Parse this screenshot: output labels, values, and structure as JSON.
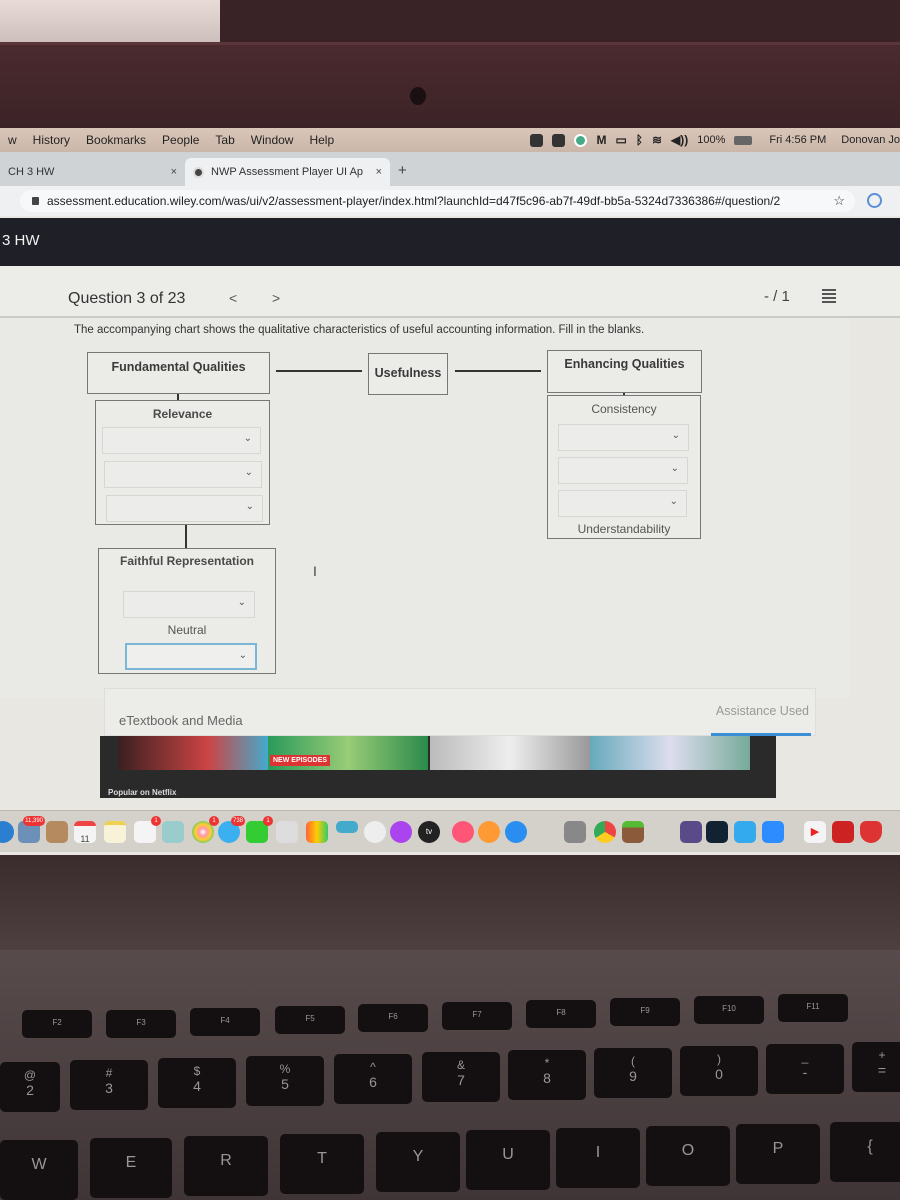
{
  "menubar": {
    "items": [
      "w",
      "History",
      "Bookmarks",
      "People",
      "Tab",
      "Window",
      "Help"
    ],
    "status_icons": [
      "zoom-icon",
      "scan-icon",
      "chrome-helper-icon",
      "malwarebytes-icon",
      "airplay-icon",
      "bluetooth-icon",
      "wifi-icon",
      "volume-icon"
    ],
    "battery": "100%",
    "clock": "Fri 4:56 PM",
    "user": "Donovan Jo"
  },
  "browser": {
    "tabs": [
      {
        "label": "CH 3 HW",
        "active": false
      },
      {
        "label": "NWP Assessment Player UI Ap",
        "active": true
      }
    ],
    "new_tab_label": "+",
    "close_label": "×",
    "url": "assessment.education.wiley.com/was/ui/v2/assessment-player/index.html?launchId=d47f5c96-ab7f-49df-bb5a-5324d7336386#/question/2",
    "star": "☆"
  },
  "app": {
    "title": "3 HW",
    "question_counter": "Question 3 of 23",
    "prev": "<",
    "next": ">",
    "score": "- / 1",
    "prompt": "The accompanying chart shows the qualitative characteristics of useful accounting information. Fill in the blanks."
  },
  "chart": {
    "fundamental": "Fundamental Qualities",
    "usefulness": "Usefulness",
    "enhancing": "Enhancing Qualities",
    "relevance": {
      "label": "Relevance",
      "dropdowns": [
        "",
        "",
        ""
      ]
    },
    "faithful": {
      "label": "Faithful Representation",
      "dropdowns": [
        ""
      ],
      "sub_label": "Neutral",
      "sub_dropdowns": [
        ""
      ]
    },
    "enhancing_box": {
      "label": "Consistency",
      "dropdowns": [
        "",
        "",
        ""
      ],
      "footer": "Understandability"
    }
  },
  "assistance": {
    "etextbook": "eTextbook and Media",
    "assistance_used": "Assistance Used"
  },
  "background_window": {
    "new_episodes": "NEW EPISODES",
    "popular": "Popular on Netflix"
  },
  "dock": {
    "badges": {
      "mail": "11,390",
      "reminders": "1",
      "photos": "1",
      "messages": "738",
      "facetime": "1"
    },
    "calendar_day": "11",
    "tv_label": "tv"
  },
  "keyboard": {
    "fkeys": [
      "F2",
      "F3",
      "F4",
      "F5",
      "F6",
      "F7",
      "F8",
      "F9",
      "F10",
      "F11"
    ],
    "number_row": [
      {
        "top": "@",
        "bottom": "2"
      },
      {
        "top": "#",
        "bottom": "3"
      },
      {
        "top": "$",
        "bottom": "4"
      },
      {
        "top": "%",
        "bottom": "5"
      },
      {
        "top": "^",
        "bottom": "6"
      },
      {
        "top": "&",
        "bottom": "7"
      },
      {
        "top": "*",
        "bottom": "8"
      },
      {
        "top": "(",
        "bottom": "9"
      },
      {
        "top": ")",
        "bottom": "0"
      },
      {
        "top": "_",
        "bottom": "-"
      },
      {
        "top": "+",
        "bottom": "="
      }
    ],
    "letter_row": [
      "W",
      "E",
      "R",
      "T",
      "Y",
      "U",
      "I",
      "O",
      "P",
      "{"
    ]
  }
}
